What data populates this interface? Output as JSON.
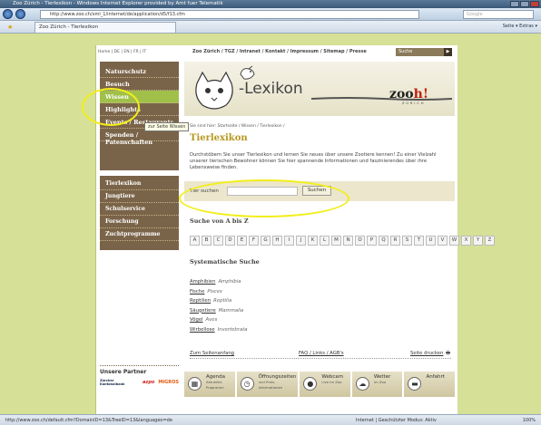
{
  "browser": {
    "title": "Zoo Zürich - Tierlexikon - Windows Internet Explorer provided by Amt fuer Telematik",
    "url": "http://www.zoo.ch/xml_1/internet/de/application/d5/f13.cfm",
    "search_placeholder": "Google",
    "tab": "Zoo Zürich - Tierlexikon",
    "tools": "Seite ▾  Extras ▾",
    "status_url": "http://www.zoo.ch/default.cfm?DomainID=13&TreeID=13&languageo=de",
    "status_right": "Internet | Geschützter Modus: Aktiv",
    "zoom": "100%"
  },
  "topnav": {
    "langs": "Home | DE | EN | FR | IT",
    "links": "Zoo Zürich / TGZ / Intranet / Kontakt / Impressum / Sitemap / Presse",
    "suche": "Suche"
  },
  "sidebar": {
    "top": [
      "Naturschutz",
      "Besuch",
      "Wissen",
      "Highlights",
      "Events / Restaurants",
      "Spenden / Patenschaften"
    ],
    "bottom": [
      "Tierlexikon",
      "Jungtiere",
      "Schulservice",
      "Forschung",
      "Zuchtprogramme"
    ],
    "tooltip": "zur Seite Wissen",
    "partner_heading": "Unsere Partner",
    "partners": [
      "Zürcher Kantonalbank",
      "azpo",
      "MIGROS"
    ]
  },
  "banner": {
    "lexikon": "-Lexikon",
    "zoo": "zoo",
    "h": "h!",
    "sub": "ZÜRICH"
  },
  "main": {
    "breadcrumb": "Sie sind hier:  Startseite / Wissen / Tierlexikon /",
    "title": "Tierlexikon",
    "intro": "Durchstöbern Sie unser Tierlexikon und lernen Sie neues über unsere Zootiere kennen! Zu einer Vielzahl unserer tierischen Bewohner können Sie hier spannende Informationen und faszinierendes über ihre Lebensweise finden.",
    "search_label": "Tier suchen",
    "search_button": "Suchen",
    "az_heading": "Suche von A bis Z",
    "letters": [
      "A",
      "B",
      "C",
      "D",
      "E",
      "F",
      "G",
      "H",
      "I",
      "J",
      "K",
      "L",
      "M",
      "N",
      "O",
      "P",
      "Q",
      "R",
      "S",
      "T",
      "U",
      "V",
      "W",
      "X",
      "Y",
      "Z"
    ],
    "sys_heading": "Systematische Suche",
    "classes": [
      {
        "de": "Amphibien",
        "la": "Amphibia"
      },
      {
        "de": "Fische",
        "la": "Pisces"
      },
      {
        "de": "Reptilien",
        "la": "Reptilia"
      },
      {
        "de": "Säugetiere",
        "la": "Mammalia"
      },
      {
        "de": "Vögel",
        "la": "Aves"
      },
      {
        "de": "Wirbellose",
        "la": "Invertebrata"
      }
    ],
    "footer": {
      "top": "Zum Seitenanfang",
      "faq": "FAQ / Links / AGB's",
      "print": "Seite drucken"
    }
  },
  "content_tabs": [
    {
      "t": "Agenda",
      "s": "Aktuelles Programm"
    },
    {
      "t": "Öffnungszeiten",
      "s": "und Preis-Informationen"
    },
    {
      "t": "Webcam",
      "s": "Live im Zoo"
    },
    {
      "t": "Wetter",
      "s": "im Zoo"
    },
    {
      "t": "Anfahrt",
      "s": ""
    }
  ],
  "colors": {
    "sidebar": "#7a6449",
    "highlight": "#f2ee1a",
    "title": "#b89820",
    "page_bg": "#d6e096"
  }
}
